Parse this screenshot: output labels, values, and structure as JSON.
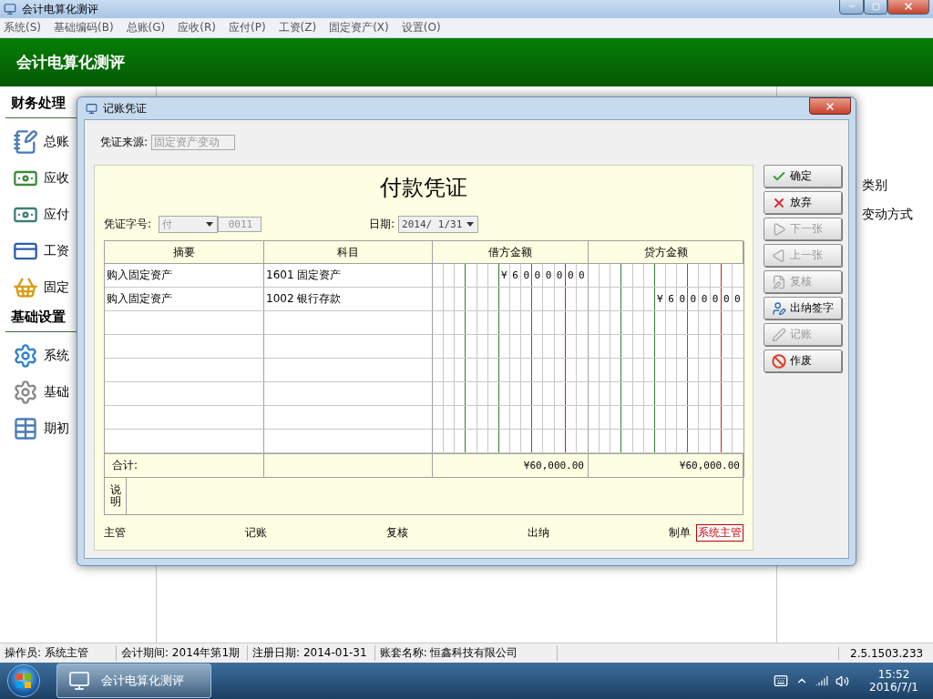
{
  "window": {
    "title": "会计电算化测评"
  },
  "menu": [
    "系统(S)",
    "基础编码(B)",
    "总账(G)",
    "应收(R)",
    "应付(P)",
    "工资(Z)",
    "固定资产(X)",
    "设置(O)"
  ],
  "header": {
    "title": "会计电算化测评"
  },
  "sidebar": {
    "sections": [
      {
        "title": "财务处理",
        "items": [
          "总账",
          "应收",
          "应付",
          "工资",
          "固定"
        ]
      },
      {
        "title": "基础设置",
        "items": [
          "系统",
          "基础",
          "期初"
        ]
      }
    ]
  },
  "right_panel": {
    "items": [
      "类别",
      "变动方式"
    ]
  },
  "dialog": {
    "title": "记账凭证",
    "source": {
      "label": "凭证来源:",
      "value": "固定资产变动"
    },
    "voucher_title": "付款凭证",
    "voucher_no": {
      "label": "凭证字号:",
      "type": "付",
      "number": "0011"
    },
    "date": {
      "label": "日期:",
      "value": "2014/ 1/31"
    },
    "columns": [
      "摘要",
      "科目",
      "借方金额",
      "贷方金额"
    ],
    "rows": [
      {
        "summary": "购入固定资产",
        "account": "1601 固定资产",
        "debit": [
          "¥",
          "6",
          "0",
          "0",
          "0",
          "0",
          "0",
          "0"
        ]
      },
      {
        "summary": "购入固定资产",
        "account": "1002 银行存款",
        "credit": [
          "¥",
          "6",
          "0",
          "0",
          "0",
          "0",
          "0",
          "0"
        ]
      }
    ],
    "total": {
      "label": "合计:",
      "debit": "¥60,000.00",
      "credit": "¥60,000.00"
    },
    "note": {
      "label": "说明"
    },
    "signatures": [
      {
        "label": "主管"
      },
      {
        "label": "记账"
      },
      {
        "label": "复核"
      },
      {
        "label": "出纳"
      },
      {
        "label": "制单",
        "value": "系统主管"
      }
    ],
    "buttons": [
      {
        "label": "确定",
        "disabled": false
      },
      {
        "label": "放弃",
        "disabled": false
      },
      {
        "label": "下一张",
        "disabled": true
      },
      {
        "label": "上一张",
        "disabled": true
      },
      {
        "label": "复核",
        "disabled": true
      },
      {
        "label": "出纳签字",
        "disabled": false
      },
      {
        "label": "记账",
        "disabled": true
      },
      {
        "label": "作废",
        "disabled": false
      }
    ]
  },
  "status_bar": [
    "操作员: 系统主管",
    "会计期间: 2014年第1期",
    "注册日期: 2014-01-31",
    "账套名称: 恒鑫科技有限公司",
    "2.5.1503.233"
  ],
  "taskbar": {
    "app": "会计电算化测评",
    "time": "15:52",
    "date": "2016/7/1"
  }
}
